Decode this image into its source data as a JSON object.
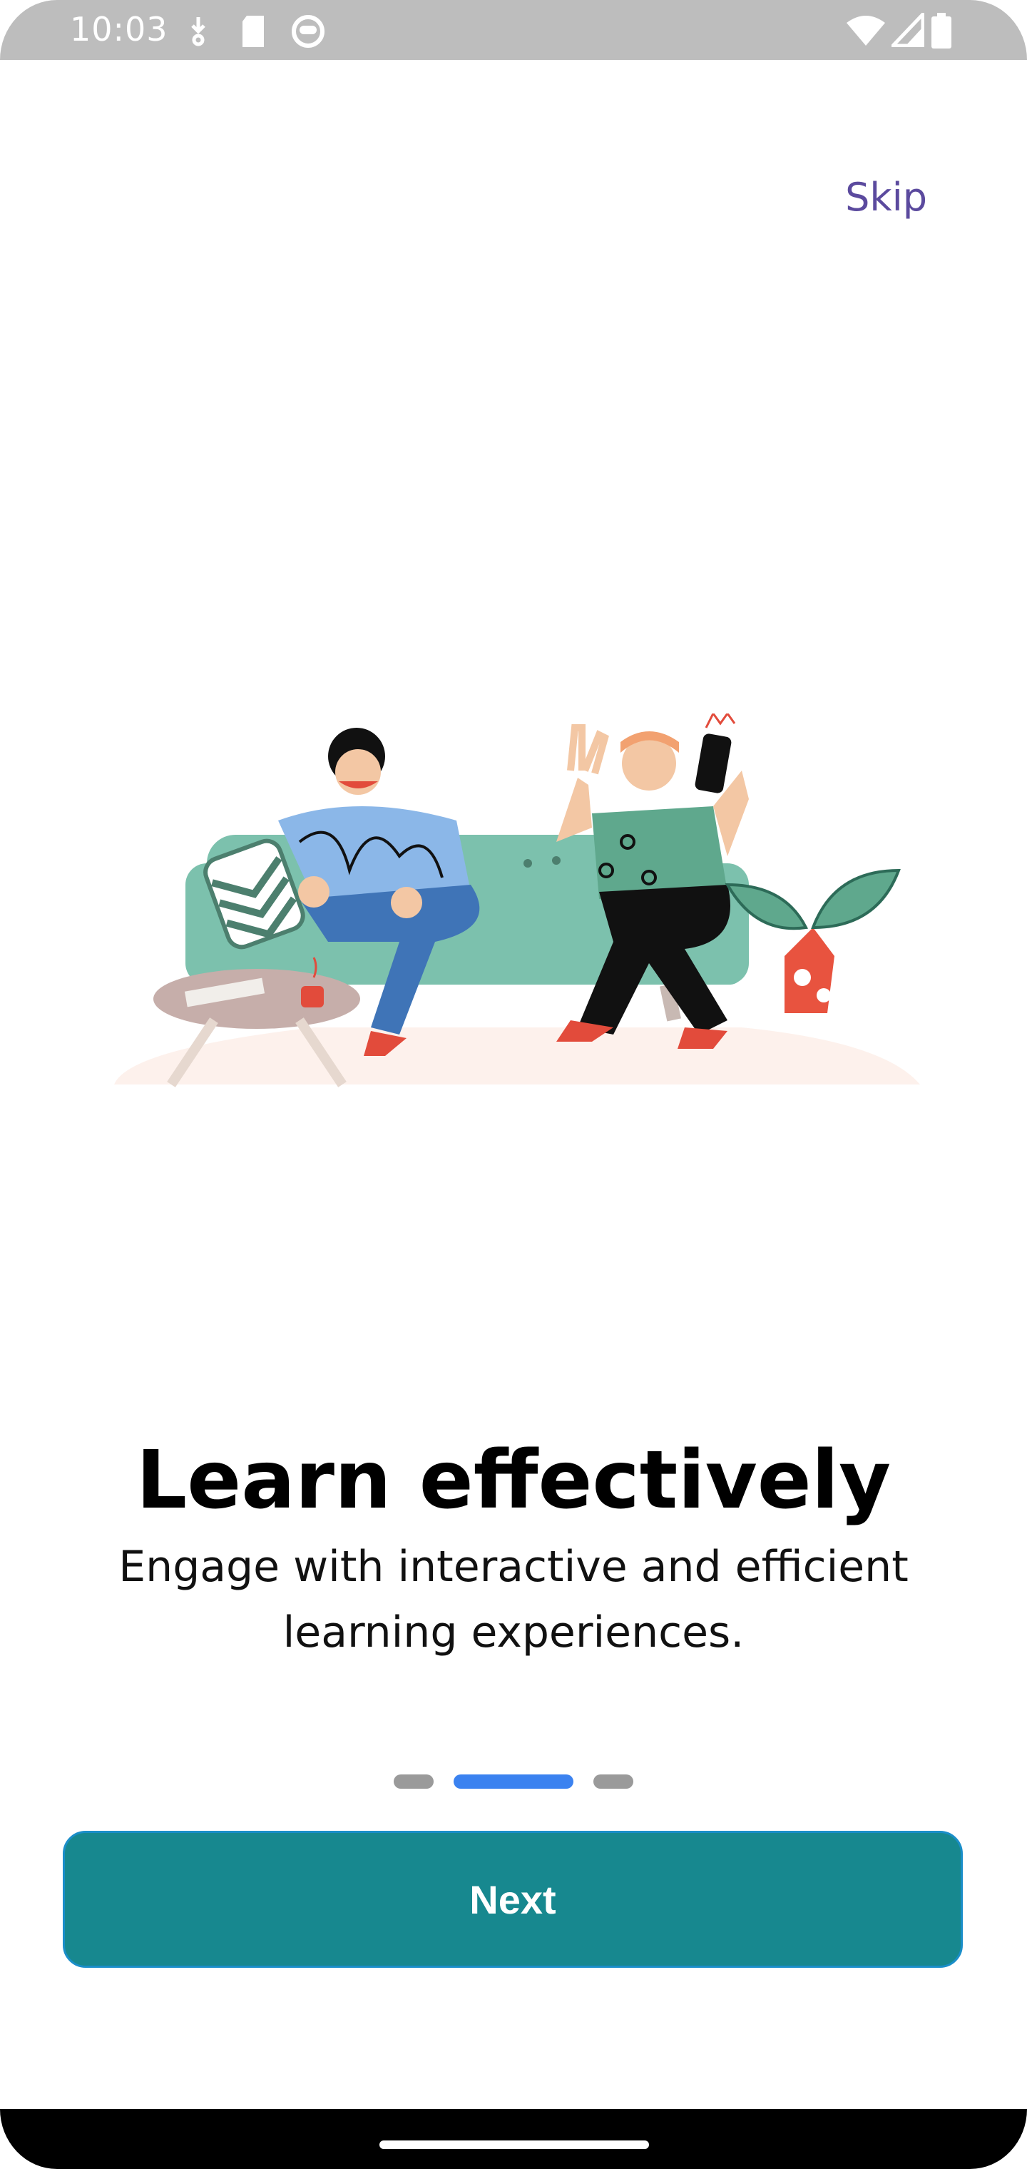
{
  "status_bar": {
    "time": "10:03",
    "left_icons": [
      "download-icon",
      "sd-card-icon",
      "face-icon"
    ],
    "right_icons": [
      "wifi-icon",
      "signal-icon",
      "battery-icon"
    ]
  },
  "onboarding": {
    "skip_label": "Skip",
    "title": "Learn effectively",
    "subtitle": "Engage with interactive and efficient learning experiences.",
    "page_indicator": {
      "total": 3,
      "active_index": 1
    },
    "next_label": "Next"
  },
  "colors": {
    "accent": "#17888f",
    "skip": "#5b4a9e",
    "indicator_active": "#3b82f0",
    "indicator_inactive": "#9a9a9a"
  }
}
